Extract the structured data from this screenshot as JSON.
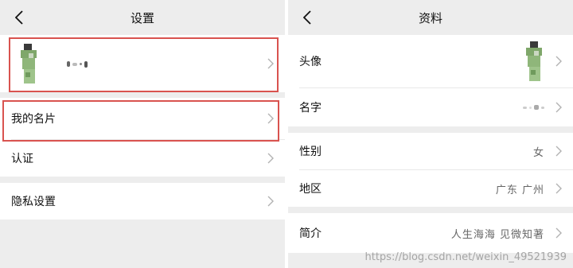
{
  "left": {
    "title": "设置",
    "items": {
      "my_card": "我的名片",
      "auth": "认证",
      "privacy": "隐私设置"
    }
  },
  "right": {
    "title": "资料",
    "rows": {
      "avatar_label": "头像",
      "name_label": "名字",
      "gender_label": "性别",
      "gender_value": "女",
      "region_label": "地区",
      "region_value": "广东 广州",
      "intro_label": "简介",
      "intro_value": "人生海海 见微知著"
    }
  },
  "watermark": "https://blog.csdn.net/weixin_49521939",
  "colors": {
    "highlight_border": "#d9534f",
    "background": "#ededed"
  }
}
